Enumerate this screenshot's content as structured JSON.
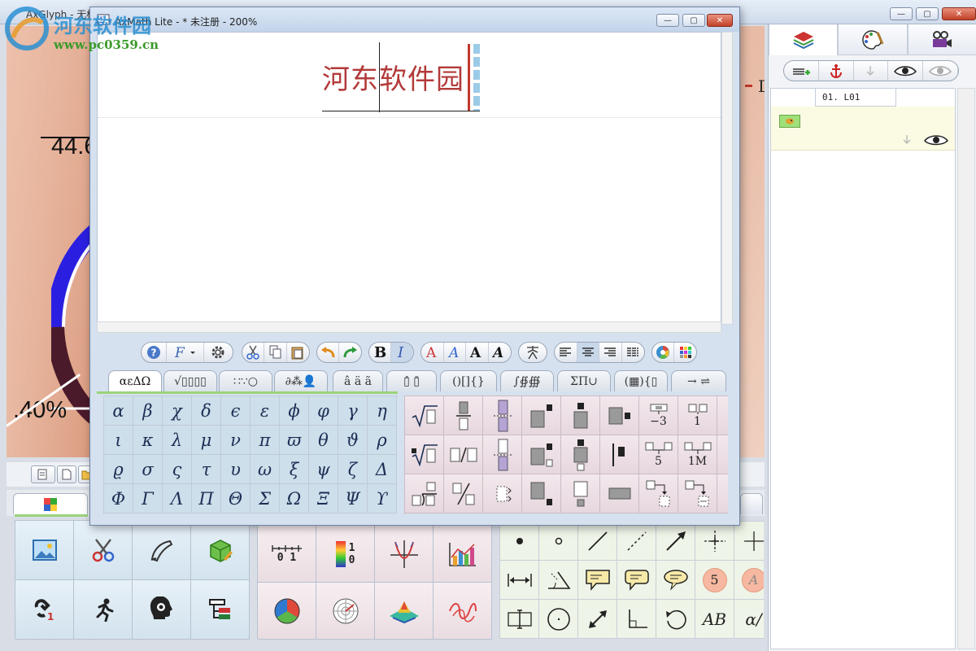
{
  "bg_app": {
    "title": "AxGlyph - 无标...",
    "value_top": "44.6",
    "value_bottom": ".40%",
    "peek_letter": "D"
  },
  "axmath": {
    "title": "AxMath Lite - * 未注册 - 200%",
    "formula": "河东软件园"
  },
  "symbol_tabs": [
    "αεΔΩ",
    "√▯▯▯▯",
    "∷∵○",
    "∂⁂👤",
    "â ä ã",
    "▯̂ ▯̄",
    "()[]{}",
    "∫∯∰",
    "ΣΠ∪",
    "(▦){▯",
    "→ ⇌"
  ],
  "greek_symbols": [
    [
      "α",
      "β",
      "χ",
      "δ",
      "ϵ",
      "ε",
      "ϕ",
      "φ",
      "γ",
      "η"
    ],
    [
      "ι",
      "κ",
      "λ",
      "μ",
      "ν",
      "π",
      "ϖ",
      "θ",
      "ϑ",
      "ρ"
    ],
    [
      "ϱ",
      "σ",
      "ς",
      "τ",
      "υ",
      "ω",
      "ξ",
      "ψ",
      "ζ",
      "Δ"
    ],
    [
      "Φ",
      "Γ",
      "Λ",
      "Π",
      "Θ",
      "Σ",
      "Ω",
      "Ξ",
      "Ψ",
      "ϒ"
    ]
  ],
  "template_labels": {
    "t1": "−3",
    "t2": "1",
    "t3": "5",
    "t4": "1M"
  },
  "draw_labels": {
    "circle_num": "5",
    "circle_letter": "A",
    "ab": "AB",
    "alpha": "α/"
  },
  "layers": {
    "name": "01. L01"
  },
  "chart_labels": {
    "scale": "0 1",
    "colorbar_top": "1",
    "colorbar_bottom": "0"
  },
  "watermark": {
    "name": "河东软件园",
    "url": "www.pc0359.cn"
  },
  "window_controls": {
    "minimize": "—",
    "maximize": "▢",
    "close": "✕"
  }
}
